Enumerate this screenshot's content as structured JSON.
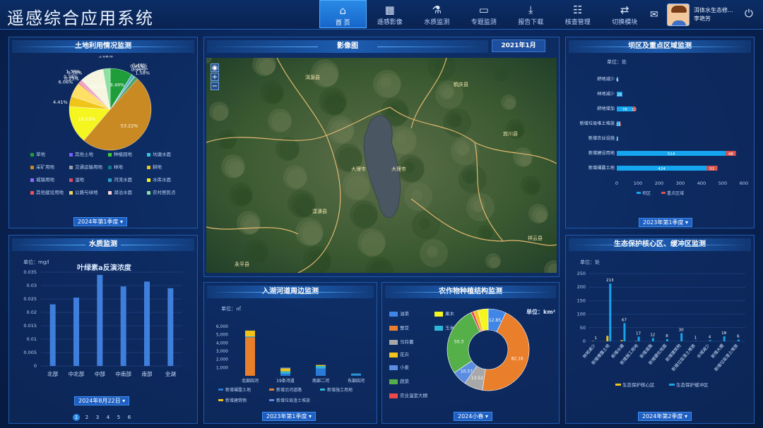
{
  "app_title": "遥感综合应用系统",
  "nav": [
    {
      "label": "首  页",
      "icon": "⌂"
    },
    {
      "label": "遥感影像",
      "icon": "▦"
    },
    {
      "label": "水质监测",
      "icon": "⚗"
    },
    {
      "label": "专题监测",
      "icon": "▭"
    },
    {
      "label": "报告下载",
      "icon": "⤓"
    },
    {
      "label": "核查管理",
      "icon": "☷"
    },
    {
      "label": "切换模块",
      "icon": "⇄"
    }
  ],
  "user": {
    "org": "洱体水生态修...",
    "name": "李艳芳"
  },
  "land": {
    "title": "土地利用情况监测",
    "selector": "2024年第1季度 ▾",
    "chart_data": {
      "type": "pie",
      "values": [
        9.49,
        0.41,
        0.44,
        0.49,
        0.17,
        1.58,
        53.22,
        16.03,
        4.41,
        6.06,
        0.38,
        0.23,
        1.38,
        0.18,
        10.02,
        3.08
      ],
      "labels": [
        "9.49%",
        "0.41%",
        "0.44%",
        "0.49%",
        "0.17%",
        "1.58%",
        "53.22%",
        "16.03%",
        "4.41%",
        "6.06%",
        "0.38%",
        "0.23%",
        "1.38%",
        "0.18%",
        "10.02%",
        "3.08%"
      ],
      "colors": [
        "#1f9d3a",
        "#36c3e0",
        "#0e7a8a",
        "#2aa0c8",
        "#76e0c8",
        "#4fa36b",
        "#c98a23",
        "#f5f520",
        "#f0c51a",
        "#ffe066",
        "#d94a6a",
        "#ee5555",
        "#f2a0c0",
        "#ffd2dc",
        "#f6f6e0",
        "#8de0a0"
      ]
    },
    "legend": [
      {
        "name": "草地",
        "color": "#1f9d3a"
      },
      {
        "name": "其他土地",
        "color": "#7a5cff"
      },
      {
        "name": "种植园地",
        "color": "#3ccf3c"
      },
      {
        "name": "坑塘水面",
        "color": "#36c3e0"
      },
      {
        "name": "采矿用地",
        "color": "#c98a23"
      },
      {
        "name": "交通运输用地",
        "color": "#9aa0a6"
      },
      {
        "name": "林地",
        "color": "#0e7a8a"
      },
      {
        "name": "耕地",
        "color": "#f0c51a"
      },
      {
        "name": "城镇用地",
        "color": "#8a6bff"
      },
      {
        "name": "湿地",
        "color": "#d94a6a"
      },
      {
        "name": "河流水面",
        "color": "#2aa0c8"
      },
      {
        "name": "水库水面",
        "color": "#f5f520"
      },
      {
        "name": "其他建设用地",
        "color": "#ee5555"
      },
      {
        "name": "公路与绿地",
        "color": "#e8d55a"
      },
      {
        "name": "湖泊水面",
        "color": "#ffd2dc"
      },
      {
        "name": "农村居民点",
        "color": "#8de0a0"
      }
    ]
  },
  "water": {
    "title": "水质监测",
    "unit": "单位：mg/l",
    "chart_title": "叶绿素a反演浓度",
    "date": "2024年8月22日 ▾",
    "pages": [
      "1",
      "2",
      "3",
      "4",
      "5",
      "6"
    ],
    "chart_data": {
      "type": "bar",
      "categories": [
        "北部",
        "中北部",
        "中部",
        "中南部",
        "南部",
        "全湖"
      ],
      "values": [
        0.023,
        0.0255,
        0.034,
        0.0297,
        0.0315,
        0.029
      ],
      "ylim": [
        0,
        0.035
      ],
      "yticks": [
        "0",
        "0.005",
        "0.01",
        "0.015",
        "0.02",
        "0.025",
        "0.03",
        "0.035"
      ]
    }
  },
  "image": {
    "title": "影像图",
    "date": "2021年1月",
    "places": [
      "洱源县",
      "鹤庆县",
      "大理市",
      "宾川县",
      "大理市",
      "漾濞县",
      "永平县",
      "祥云县"
    ]
  },
  "dam": {
    "title": "坝区及重点区域监测",
    "unit": "单位：处",
    "selector": "2023年第1季度 ▾",
    "chart_data": {
      "type": "bar",
      "categories": [
        "耕地减少",
        "林地减少",
        "耕地增加",
        "新增垃圾堆土堆放",
        "新增农业设施",
        "新增建设用地",
        "新增裸露土地"
      ],
      "series": [
        {
          "name": "坝区",
          "values": [
            6,
            26,
            76,
            13,
            2,
            514,
            424
          ],
          "color": "#15a6ef"
        },
        {
          "name": "重点区域",
          "values": [
            0,
            0,
            12,
            1,
            0,
            48,
            51
          ],
          "color": "#d9534f"
        }
      ],
      "xlim": [
        0,
        600
      ],
      "xticks": [
        "0",
        "100",
        "200",
        "300",
        "400",
        "500",
        "600"
      ]
    }
  },
  "river": {
    "title": "入湖河道周边监测",
    "unit": "单位：㎡",
    "selector": "2023年第1季度 ▾",
    "chart_data": {
      "type": "bar",
      "categories": [
        "北部四河",
        "19条河道",
        "南部二河",
        "东部四河"
      ],
      "ylim": [
        0,
        6000
      ],
      "yticks": [
        "1,000",
        "2,000",
        "3,000",
        "4,000",
        "5,000",
        "6,000"
      ],
      "series": [
        {
          "name": "新增裸露土地",
          "values": [
            0,
            250,
            900,
            150
          ],
          "color": "#2a7ad8"
        },
        {
          "name": "新增沿河道路",
          "values": [
            4700,
            0,
            0,
            0
          ],
          "color": "#e97e2b"
        },
        {
          "name": "新增施工用地",
          "values": [
            100,
            300,
            300,
            120
          ],
          "color": "#2fb6d6"
        },
        {
          "name": "新增建筑物",
          "values": [
            700,
            350,
            120,
            0
          ],
          "color": "#f2c318"
        },
        {
          "name": "新增垃圾渣土堆放",
          "values": [
            0,
            100,
            0,
            0
          ],
          "color": "#5b8de0"
        }
      ],
      "legend": [
        "新增裸露土地",
        "新增沿河道路",
        "新增施工用地",
        "新增建筑物",
        "新增垃圾渣土堆放"
      ]
    }
  },
  "crop": {
    "title": "农作物种植结构监测",
    "unit": "单位：km²",
    "selector": "2024小春 ▾",
    "legend": [
      {
        "name": "油菜",
        "color": "#3f86e6"
      },
      {
        "name": "果木",
        "color": "#f5f520"
      },
      {
        "name": "蚕豆",
        "color": "#e97e2b"
      },
      {
        "name": "玉米",
        "color": "#2fb6d6"
      },
      {
        "name": "马铃薯",
        "color": "#a8a8a8"
      },
      {
        "name": "花卉",
        "color": "#f2c318"
      },
      {
        "name": "小麦",
        "color": "#5b8de0"
      },
      {
        "name": "蔬菜",
        "color": "#56b04a"
      },
      {
        "name": "农业温室大棚",
        "color": "#e84a4a"
      }
    ],
    "chart_data": {
      "type": "pie",
      "values": [
        12.85,
        82.16,
        13.52,
        10.57,
        50.3,
        2.0,
        3.0,
        7.5
      ],
      "labels": [
        "12.85",
        "82.16",
        "13.52",
        "10.57",
        "50.3",
        "",
        "",
        ""
      ],
      "colors": [
        "#3f86e6",
        "#e97e2b",
        "#a8a8a8",
        "#5b8de0",
        "#56b04a",
        "#e84a4a",
        "#f2c318",
        "#f5f520"
      ]
    }
  },
  "eco": {
    "title": "生态保护核心区、缓冲区监测",
    "unit": "单位：处",
    "selector": "2024年第2季度 ▾",
    "chart_data": {
      "type": "bar",
      "categories": [
        "林地减少",
        "新增裸露土地",
        "新增水塘",
        "新增施工用地",
        "新增道路",
        "新增硬化地面",
        "新增建筑物",
        "新增垃圾渣土堆放",
        "水域减少",
        "新增大棚",
        "新增垃圾渣土堆放"
      ],
      "ylim": [
        0,
        250
      ],
      "yticks": [
        "0",
        "50",
        "100",
        "150",
        "200",
        "250"
      ],
      "series": [
        {
          "name": "生态保护核心区",
          "values": [
            1,
            20,
            4,
            1,
            0,
            0,
            0,
            0,
            0,
            0,
            0
          ],
          "color": "#f2c318"
        },
        {
          "name": "生态保护缓冲区",
          "values": [
            0,
            213,
            67,
            17,
            12,
            8,
            30,
            1,
            4,
            18,
            6
          ],
          "color": "#1aa2ea"
        }
      ],
      "labels": [
        "1",
        "213",
        "67",
        "17",
        "12",
        "8",
        "30",
        "1",
        "4",
        "18",
        "6"
      ]
    }
  }
}
